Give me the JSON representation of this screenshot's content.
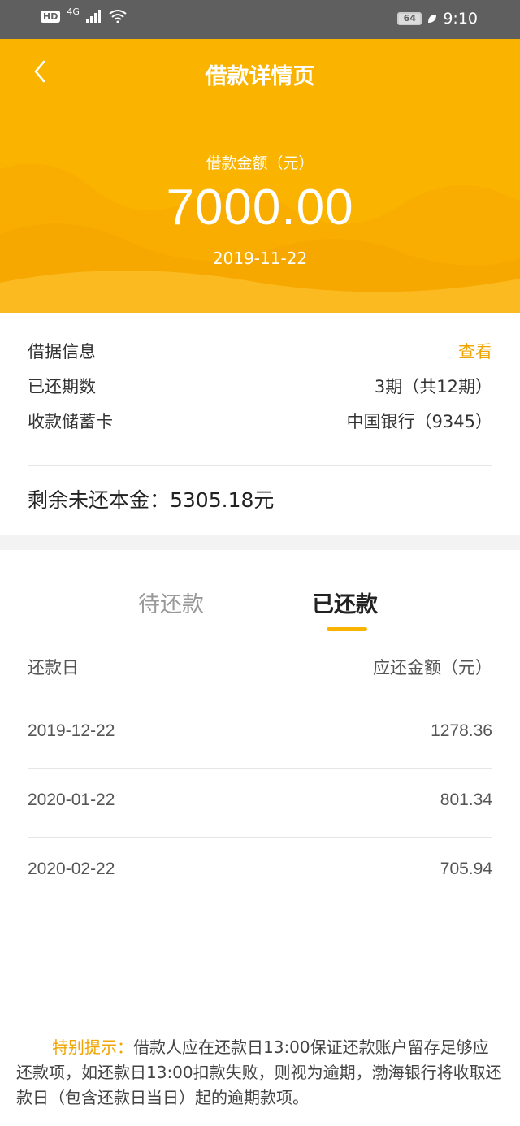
{
  "status_bar": {
    "hd": "HD",
    "network": "4G",
    "battery": "64",
    "time": "9:10"
  },
  "header": {
    "title": "借款详情页",
    "amount_label": "借款金额（元）",
    "amount": "7000.00",
    "date": "2019-11-22"
  },
  "info": {
    "rows": [
      {
        "label": "借据信息",
        "value": "查看"
      },
      {
        "label": "已还期数",
        "value": "3期（共12期）"
      },
      {
        "label": "收款储蓄卡",
        "value": "中国银行（9345）"
      }
    ],
    "remaining": "剩余未还本金：5305.18元"
  },
  "tabs": {
    "pending": "待还款",
    "paid": "已还款"
  },
  "table": {
    "headers": [
      "还款日",
      "应还金额（元）"
    ],
    "rows": [
      {
        "date": "2019-12-22",
        "amount": "1278.36"
      },
      {
        "date": "2020-01-22",
        "amount": "801.34"
      },
      {
        "date": "2020-02-22",
        "amount": "705.94"
      }
    ]
  },
  "notice": {
    "label": "特别提示：",
    "text": "借款人应在还款日13:00保证还款账户留存足够应还款项，如还款日13:00扣款失败，则视为逾期，渤海银行将收取还款日（包含还款日当日）起的逾期款项。"
  },
  "colors": {
    "accent": "#fab400",
    "link": "#f0a500"
  }
}
